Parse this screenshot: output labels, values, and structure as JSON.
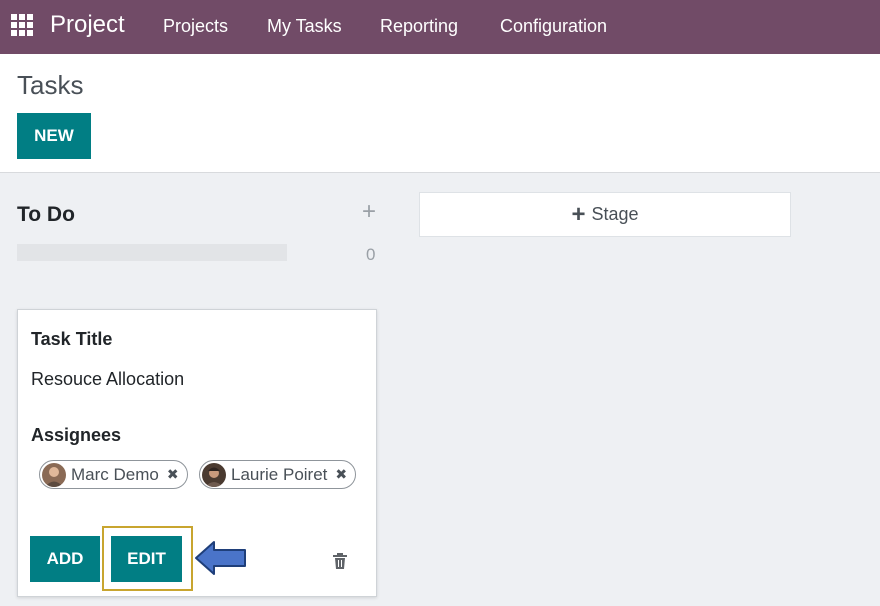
{
  "topbar": {
    "app_name": "Project",
    "nav": [
      "Projects",
      "My Tasks",
      "Reporting",
      "Configuration"
    ],
    "background_color": "#714b67"
  },
  "control_panel": {
    "title": "Tasks",
    "new_button": "NEW"
  },
  "kanban": {
    "column": {
      "title": "To Do",
      "count": "0"
    },
    "add_stage_label": "Stage",
    "quick_create": {
      "title_label": "Task Title",
      "title_value": "Resouce Allocation",
      "assignees_label": "Assignees",
      "assignees": [
        "Marc Demo",
        "Laurie Poiret"
      ],
      "add_button": "ADD",
      "edit_button": "EDIT"
    }
  },
  "icons": {
    "apps": "apps-grid-icon",
    "column_add": "plus-icon",
    "stage_add": "plus-icon",
    "remove_tag": "x-icon",
    "delete": "trash-icon",
    "pointer": "arrow-left-icon"
  },
  "colors": {
    "primary": "#017e84",
    "highlight": "#c8a52f",
    "arrow": "#4a74c9"
  }
}
